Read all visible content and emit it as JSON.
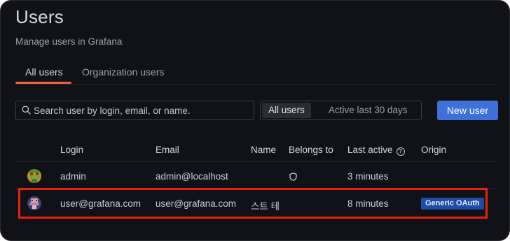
{
  "page": {
    "title": "Users",
    "subtitle": "Manage users in Grafana"
  },
  "tabs": [
    {
      "label": "All users",
      "active": true
    },
    {
      "label": "Organization users",
      "active": false
    }
  ],
  "search": {
    "placeholder": "Search user by login, email, or name.",
    "value": ""
  },
  "filter": {
    "options": [
      "All users",
      "Active last 30 days"
    ],
    "selected": "All users"
  },
  "new_user_button": {
    "label": "New user"
  },
  "table": {
    "columns": [
      "Login",
      "Email",
      "Name",
      "Belongs to",
      "Last active",
      "Origin"
    ],
    "rows": [
      {
        "login": "admin",
        "email": "admin@localhost",
        "name": "",
        "belongs_to_icon": "shield-icon",
        "last_active": "3 minutes",
        "origin": ""
      },
      {
        "login": "user@grafana.com",
        "email": "user@grafana.com",
        "name": "스트 테",
        "belongs_to_icon": "",
        "last_active": "8 minutes",
        "origin": "Generic OAuth"
      }
    ]
  },
  "colors": {
    "background": "#111217",
    "primary_button": "#3d71d9",
    "active_tab_indicator": "#f55f3e",
    "origin_badge": "#1f4ca7",
    "highlight_box": "#e8230c"
  }
}
